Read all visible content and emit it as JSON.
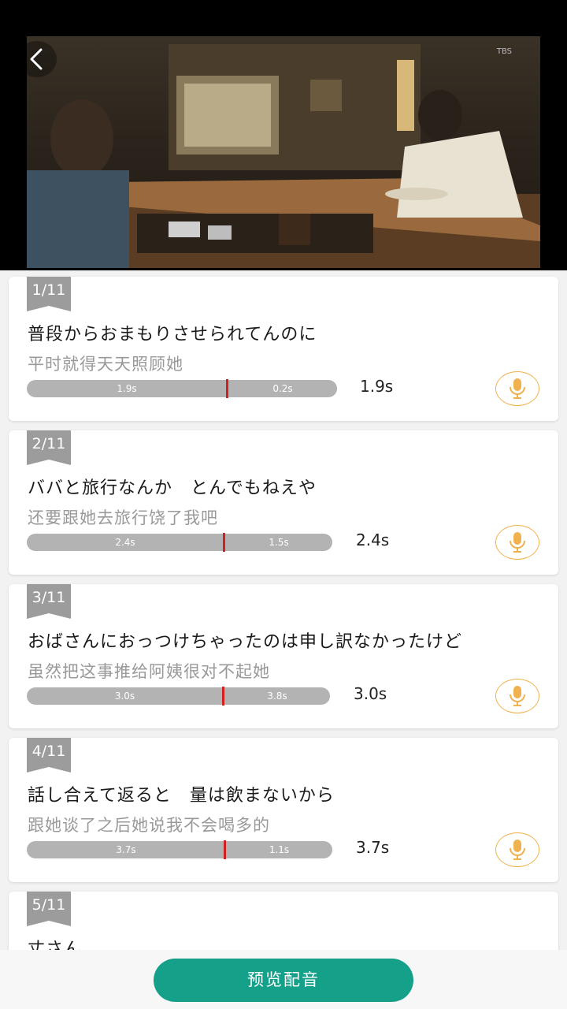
{
  "video": {
    "watermark": "TBS"
  },
  "items": [
    {
      "index": "1/11",
      "jp": "普段からおまもりさせられてんのに",
      "cn": "平时就得天天照顾她",
      "seg1": "1.9s",
      "seg2": "0.2s",
      "duration": "1.9s"
    },
    {
      "index": "2/11",
      "jp": "ババと旅行なんか　とんでもねえや",
      "cn": "还要跟她去旅行饶了我吧",
      "seg1": "2.4s",
      "seg2": "1.5s",
      "duration": "2.4s"
    },
    {
      "index": "3/11",
      "jp": "おばさんにおっつけちゃったのは申し訳なかったけど",
      "cn": "虽然把这事推给阿姨很对不起她",
      "seg1": "3.0s",
      "seg2": "3.8s",
      "duration": "3.0s"
    },
    {
      "index": "4/11",
      "jp": "話し合えて返ると　量は飲まないから",
      "cn": "跟她谈了之后她说我不会喝多的",
      "seg1": "3.7s",
      "seg2": "1.1s",
      "duration": "3.7s"
    },
    {
      "index": "5/11",
      "jp": "丈さん",
      "cn": "",
      "seg1": "",
      "seg2": "",
      "duration": ""
    }
  ],
  "bottom": {
    "preview_label": "预览配音"
  },
  "colors": {
    "accent": "#15a08a",
    "mic": "#f0b24e",
    "marker": "#d21f1f"
  }
}
